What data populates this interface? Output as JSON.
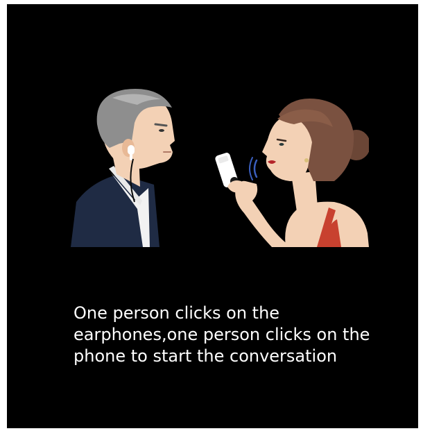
{
  "caption": {
    "lines": [
      "One person clicks on the",
      "earphones,one person clicks on the",
      "phone to start the conversation"
    ]
  },
  "colors": {
    "background": "#000000",
    "caption_text": "#ffffff",
    "suit": "#1f2b44",
    "dress": "#c8412f",
    "skin": "#f3d1b5"
  },
  "illustration": {
    "left_person": "man-with-earphone",
    "right_person": "woman-speaking-into-phone"
  }
}
